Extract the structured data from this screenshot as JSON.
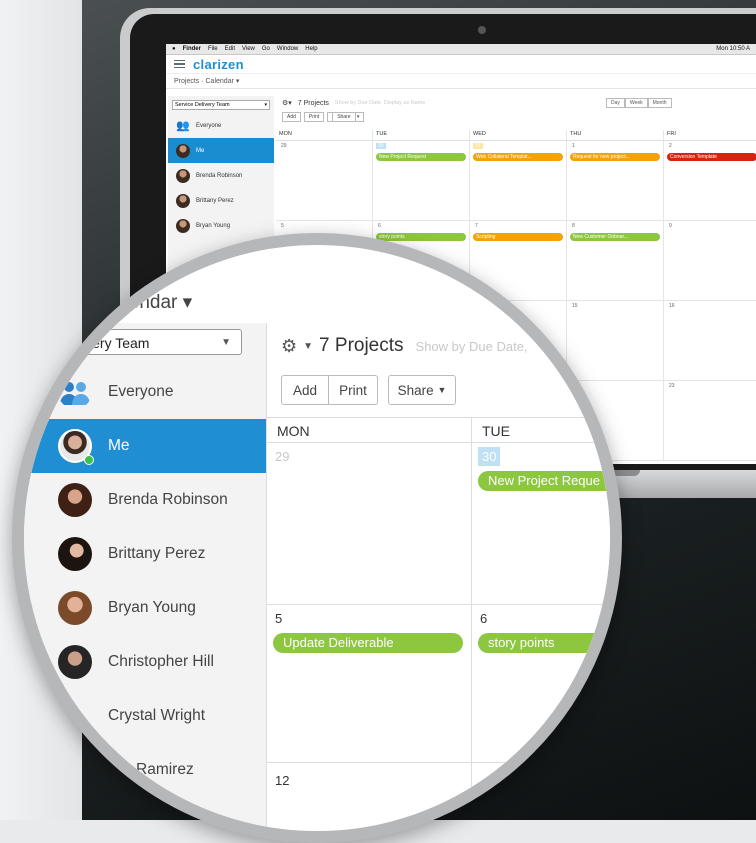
{
  "menubar": {
    "items": [
      "Finder",
      "File",
      "Edit",
      "View",
      "Go",
      "Window",
      "Help"
    ],
    "clock": "Mon 10:50 A"
  },
  "app": {
    "logo": "clarizen",
    "breadcrumb": "Projects · Calendar ▾"
  },
  "sidebar": {
    "team_select": "Service Delivery Team",
    "users": [
      {
        "name": "Everyone",
        "icon": "group-icon"
      },
      {
        "name": "Me",
        "icon": "avatar",
        "selected": true
      },
      {
        "name": "Brenda Robinson",
        "icon": "avatar"
      },
      {
        "name": "Brittany Perez",
        "icon": "avatar"
      },
      {
        "name": "Bryan Young",
        "icon": "avatar"
      },
      {
        "name": "Christopher Hill",
        "icon": "avatar"
      },
      {
        "name": "Crystal Wright",
        "icon": "avatar"
      },
      {
        "name": "Ramirez",
        "icon": "avatar"
      }
    ]
  },
  "toolbar": {
    "projects": "7 Projects",
    "hint": "Show by Due Date, Display as Name",
    "add": "Add",
    "print": "Print",
    "share": "Share",
    "views": [
      "Day",
      "Week",
      "Month"
    ]
  },
  "calendar": {
    "days": [
      "MON",
      "TUE",
      "WED",
      "THU",
      "FRI"
    ],
    "week1": [
      "29",
      "30",
      "31",
      "1",
      "2"
    ],
    "week2": [
      "5",
      "6",
      "7",
      "8",
      "9"
    ],
    "week3": [
      "12",
      "",
      "",
      "15",
      "16"
    ],
    "week4": [
      "",
      "",
      "",
      "22",
      "23"
    ],
    "events_week1": [
      "",
      "New Project Request",
      "Web Collateral Templat...",
      "Request for new project...",
      "Conversion Template"
    ],
    "events_week2": [
      "Update Deliverable",
      "story points",
      "Scripting",
      "New Customer Onboar...",
      ""
    ]
  },
  "magnified": {
    "breadcrumb": "alendar ▾",
    "team_select": "Delivery Team",
    "hint": "Show by Due Date,",
    "new_project": "New Project Reque"
  },
  "colors": {
    "accent": "#1f8ed3",
    "green": "#8dc63f",
    "orange": "#f0a30a",
    "red": "#d9230f"
  }
}
